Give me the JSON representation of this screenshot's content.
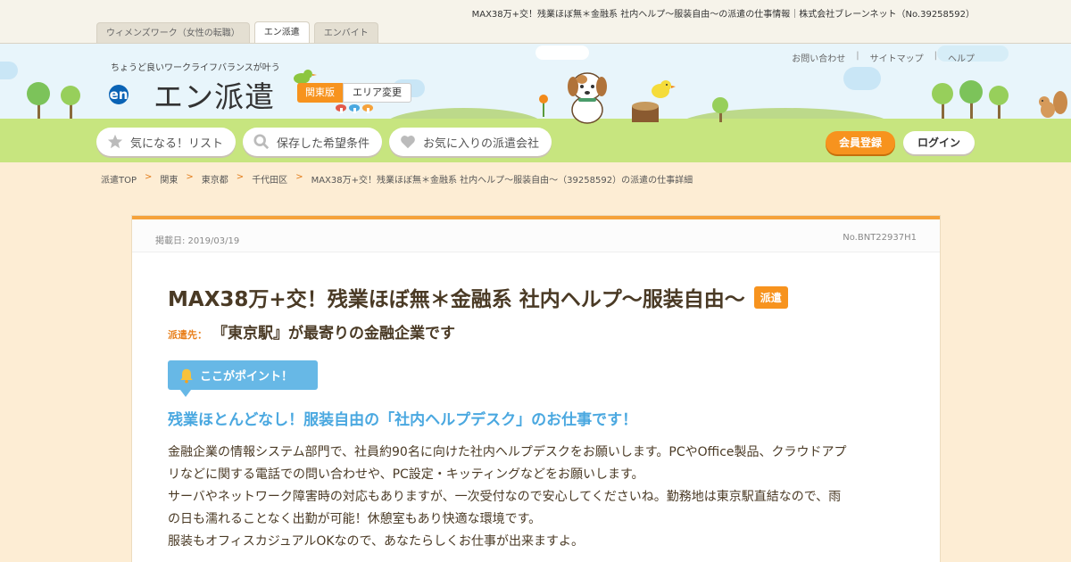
{
  "page_title": "MAX38万+交！残業ほぼ無＊金融系 社内ヘルプ～服装自由～の派遣の仕事情報｜株式会社ブレーンネット（No.39258592）",
  "tabs": [
    {
      "label": "ウィメンズワーク（女性の転職）",
      "active": false
    },
    {
      "label": "エン派遣",
      "active": true
    },
    {
      "label": "エンバイト",
      "active": false
    }
  ],
  "header": {
    "tagline": "ちょうど良いワークライフバランスが叶う",
    "logo_mark": "en",
    "logo_text": "エン派遣",
    "region": "関東版",
    "region_change": "エリア変更",
    "util_links": [
      "お問い合わせ",
      "サイトマップ",
      "ヘルプ"
    ],
    "nav": [
      {
        "label": "気になる！リスト",
        "icon": "star-icon"
      },
      {
        "label": "保存した希望条件",
        "icon": "search-icon"
      },
      {
        "label": "お気に入りの派遣会社",
        "icon": "heart-icon"
      }
    ],
    "member_register": "会員登録",
    "login": "ログイン"
  },
  "breadcrumb": [
    "派遣TOP",
    "関東",
    "東京都",
    "千代田区",
    "MAX38万+交！残業ほぼ無＊金融系 社内ヘルプ～服装自由～（39258592）の派遣の仕事詳細"
  ],
  "job": {
    "posted_date": "掲載日: 2019/03/19",
    "job_number": "No.BNT22937H1",
    "title": "MAX38万+交！残業ほぼ無＊金融系 社内ヘルプ～服装自由～",
    "type_badge": "派遣",
    "dest_label": "派遣先：",
    "dest_value": "『東京駅』が最寄りの金融企業です",
    "point_label": "ここがポイント！",
    "catch": "残業ほとんどなし！服装自由の「社内ヘルプデスク」のお仕事です！",
    "description_lines": [
      "金融企業の情報システム部門で、社員約90名に向けた社内ヘルプデスクをお願いします。PCやOffice製品、クラウドアプ",
      "リなどに関する電話での問い合わせや、PC設定・キッティングなどをお願いします。",
      "サーバやネットワーク障害時の対応もありますが、一次受付なので安心してくださいね。勤務地は東京駅直結なので、雨",
      "の日も濡れることなく出勤が可能！休憩室もあり快適な環境です。",
      "服装もオフィスカジュアルOKなので、あなたらしくお仕事が出来ますよ。"
    ]
  },
  "colors": {
    "accent": "#f7931e",
    "point_blue": "#67b8e6",
    "background": "#fdedd4"
  }
}
